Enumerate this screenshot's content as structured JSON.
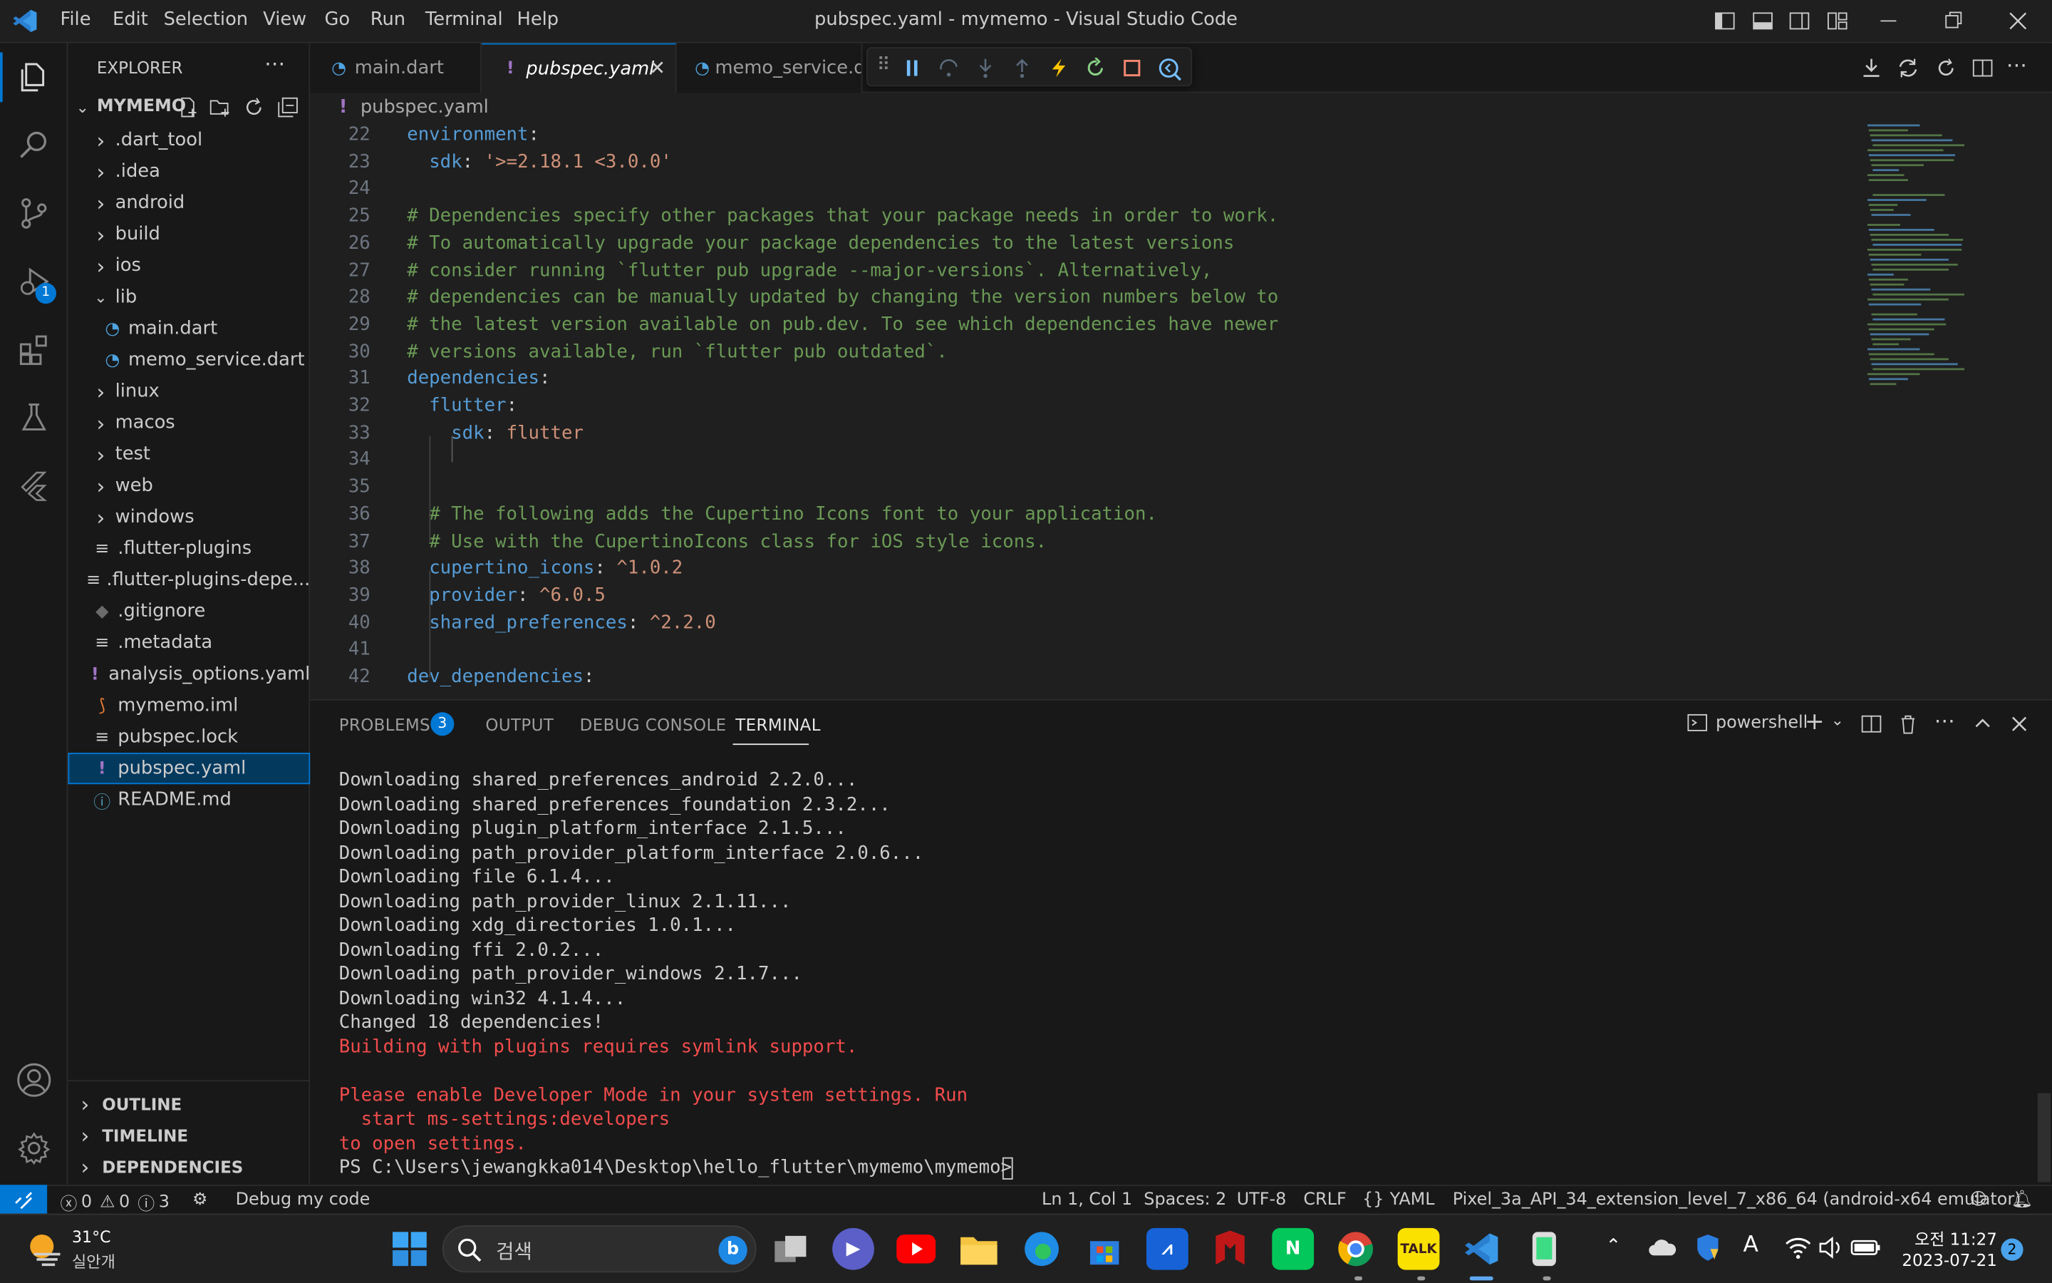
{
  "window": {
    "title": "pubspec.yaml - mymemo - Visual Studio Code"
  },
  "menu": [
    "File",
    "Edit",
    "Selection",
    "View",
    "Go",
    "Run",
    "Terminal",
    "Help"
  ],
  "explorer": {
    "header": "EXPLORER",
    "root": "MYMEMO",
    "items": [
      {
        "label": ".dart_tool",
        "type": "folder"
      },
      {
        "label": ".idea",
        "type": "folder"
      },
      {
        "label": "android",
        "type": "folder"
      },
      {
        "label": "build",
        "type": "folder"
      },
      {
        "label": "ios",
        "type": "folder"
      },
      {
        "label": "lib",
        "type": "folder-open"
      },
      {
        "label": "main.dart",
        "type": "dart"
      },
      {
        "label": "memo_service.dart",
        "type": "dart"
      },
      {
        "label": "linux",
        "type": "folder"
      },
      {
        "label": "macos",
        "type": "folder"
      },
      {
        "label": "test",
        "type": "folder"
      },
      {
        "label": "web",
        "type": "folder"
      },
      {
        "label": "windows",
        "type": "folder"
      },
      {
        "label": ".flutter-plugins",
        "type": "lines"
      },
      {
        "label": ".flutter-plugins-depe...",
        "type": "lines"
      },
      {
        "label": ".gitignore",
        "type": "git"
      },
      {
        "label": ".metadata",
        "type": "lines"
      },
      {
        "label": "analysis_options.yaml",
        "type": "yaml"
      },
      {
        "label": "mymemo.iml",
        "type": "rss"
      },
      {
        "label": "pubspec.lock",
        "type": "lines"
      },
      {
        "label": "pubspec.yaml",
        "type": "yaml"
      },
      {
        "label": "README.md",
        "type": "info"
      }
    ],
    "sections": [
      "OUTLINE",
      "TIMELINE",
      "DEPENDENCIES"
    ]
  },
  "tabs": [
    {
      "label": "main.dart"
    },
    {
      "label": "pubspec.yaml"
    },
    {
      "label": "memo_service.da"
    }
  ],
  "breadcrumb": "pubspec.yaml",
  "editor_lines": [
    {
      "n": "22",
      "t": [
        [
          "k",
          "environment"
        ],
        [
          "p",
          ":"
        ]
      ]
    },
    {
      "n": "23",
      "t": [
        [
          "p",
          "  "
        ],
        [
          "k",
          "sdk"
        ],
        [
          "p",
          ": "
        ],
        [
          "s",
          "'>=2.18.1 <3.0.0'"
        ]
      ]
    },
    {
      "n": "24",
      "t": []
    },
    {
      "n": "25",
      "t": [
        [
          "c",
          "# Dependencies specify other packages that your package needs in order to work."
        ]
      ]
    },
    {
      "n": "26",
      "t": [
        [
          "c",
          "# To automatically upgrade your package dependencies to the latest versions"
        ]
      ]
    },
    {
      "n": "27",
      "t": [
        [
          "c",
          "# consider running `flutter pub upgrade --major-versions`. Alternatively,"
        ]
      ]
    },
    {
      "n": "28",
      "t": [
        [
          "c",
          "# dependencies can be manually updated by changing the version numbers below to"
        ]
      ]
    },
    {
      "n": "29",
      "t": [
        [
          "c",
          "# the latest version available on pub.dev. To see which dependencies have newer"
        ]
      ]
    },
    {
      "n": "30",
      "t": [
        [
          "c",
          "# versions available, run `flutter pub outdated`."
        ]
      ]
    },
    {
      "n": "31",
      "t": [
        [
          "k",
          "dependencies"
        ],
        [
          "p",
          ":"
        ]
      ]
    },
    {
      "n": "32",
      "t": [
        [
          "p",
          "  "
        ],
        [
          "k",
          "flutter"
        ],
        [
          "p",
          ":"
        ]
      ]
    },
    {
      "n": "33",
      "t": [
        [
          "p",
          "    "
        ],
        [
          "k",
          "sdk"
        ],
        [
          "p",
          ": "
        ],
        [
          "s",
          "flutter"
        ]
      ]
    },
    {
      "n": "34",
      "t": []
    },
    {
      "n": "35",
      "t": []
    },
    {
      "n": "36",
      "t": [
        [
          "p",
          "  "
        ],
        [
          "c",
          "# The following adds the Cupertino Icons font to your application."
        ]
      ]
    },
    {
      "n": "37",
      "t": [
        [
          "p",
          "  "
        ],
        [
          "c",
          "# Use with the CupertinoIcons class for iOS style icons."
        ]
      ]
    },
    {
      "n": "38",
      "t": [
        [
          "p",
          "  "
        ],
        [
          "k",
          "cupertino_icons"
        ],
        [
          "p",
          ": "
        ],
        [
          "s",
          "^1.0.2"
        ]
      ]
    },
    {
      "n": "39",
      "t": [
        [
          "p",
          "  "
        ],
        [
          "k",
          "provider"
        ],
        [
          "p",
          ": "
        ],
        [
          "s",
          "^6.0.5"
        ]
      ]
    },
    {
      "n": "40",
      "t": [
        [
          "p",
          "  "
        ],
        [
          "k",
          "shared_preferences"
        ],
        [
          "p",
          ": "
        ],
        [
          "s",
          "^2.2.0"
        ]
      ]
    },
    {
      "n": "41",
      "t": []
    },
    {
      "n": "42",
      "t": [
        [
          "k",
          "dev_dependencies"
        ],
        [
          "p",
          ":"
        ]
      ]
    }
  ],
  "panel": {
    "tabs": [
      "PROBLEMS",
      "OUTPUT",
      "DEBUG CONSOLE",
      "TERMINAL"
    ],
    "problems_count": "3",
    "shell": "powershell",
    "terminal_lines": [
      {
        "t": "Downloading shared_preferences_android 2.2.0...",
        "red": false
      },
      {
        "t": "Downloading shared_preferences_foundation 2.3.2...",
        "red": false
      },
      {
        "t": "Downloading plugin_platform_interface 2.1.5...",
        "red": false
      },
      {
        "t": "Downloading path_provider_platform_interface 2.0.6...",
        "red": false
      },
      {
        "t": "Downloading file 6.1.4...",
        "red": false
      },
      {
        "t": "Downloading path_provider_linux 2.1.11...",
        "red": false
      },
      {
        "t": "Downloading xdg_directories 1.0.1...",
        "red": false
      },
      {
        "t": "Downloading ffi 2.0.2...",
        "red": false
      },
      {
        "t": "Downloading path_provider_windows 2.1.7...",
        "red": false
      },
      {
        "t": "Downloading win32 4.1.4...",
        "red": false
      },
      {
        "t": "Changed 18 dependencies!",
        "red": false
      },
      {
        "t": "Building with plugins requires symlink support.",
        "red": true
      },
      {
        "t": "",
        "red": false
      },
      {
        "t": "Please enable Developer Mode in your system settings. Run",
        "red": true
      },
      {
        "t": "  start ms-settings:developers",
        "red": true
      },
      {
        "t": "to open settings.",
        "red": true
      },
      {
        "t": "PS C:\\Users\\jewangkka014\\Desktop\\hello_flutter\\mymemo\\mymemo> ",
        "red": false
      }
    ]
  },
  "status": {
    "errors": "0",
    "warnings": "0",
    "infos": "3",
    "debug": "Debug my code",
    "position": "Ln 1, Col 1",
    "spaces": "Spaces: 2",
    "encoding": "UTF-8",
    "eol": "CRLF",
    "language": "YAML",
    "device": "Pixel_3a_API_34_extension_level_7_x86_64 (android-x64 emulator)"
  },
  "activity": {
    "debug_badge": "1"
  },
  "taskbar": {
    "weather_temp": "31°C",
    "weather_desc": "실안개",
    "search_placeholder": "검색",
    "time": "오전 11:27",
    "date": "2023-07-21",
    "notif_count": "2"
  }
}
